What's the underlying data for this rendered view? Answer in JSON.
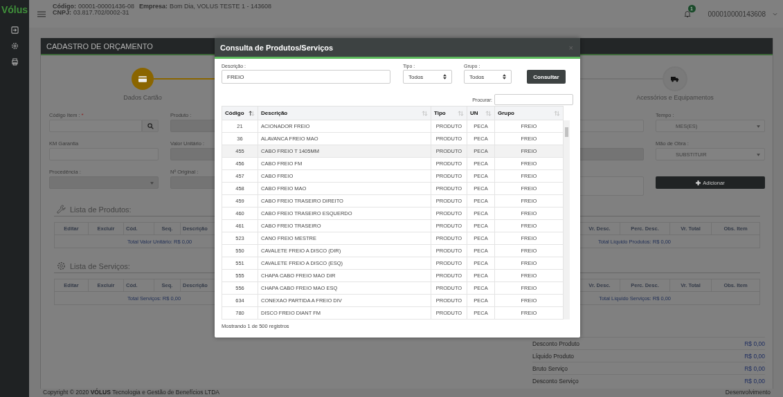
{
  "logo": "Vólus",
  "header": {
    "codigo_label": "Código:",
    "codigo": "00001-00001436-08",
    "empresa_label": "Empresa:",
    "empresa": "Bom Dia, VOLUS TESTE 1 - 143608",
    "cnpj_label": "CNPJ:",
    "cnpj": "03.817.702/0002-31",
    "notification_count": "1",
    "user": "000010000143608"
  },
  "page_title": "CADASTRO DE ORÇAMENTO",
  "steps": [
    {
      "label": "Dados Cartão",
      "active": true
    },
    {
      "label": "Acessórios e Equipamentos",
      "active": false
    }
  ],
  "form": {
    "left": [
      {
        "label": "Código Item :",
        "required_mark": "*",
        "kind": "search"
      },
      {
        "label": "KM Garantia",
        "kind": "text"
      },
      {
        "label": "Procedência :",
        "kind": "select"
      }
    ],
    "middle": [
      {
        "label": "Produto :"
      },
      {
        "label": "Valor Unitário :"
      },
      {
        "label": "Nº Original :"
      }
    ],
    "right": [
      {
        "label": "Tempo :",
        "value": "MES(ES)"
      },
      {
        "label": "Mão de Obra :",
        "value": "SUBSTITUIR"
      }
    ],
    "add_button": "Adicionar"
  },
  "lists": [
    {
      "title": "Lista de Produtos:",
      "left_columns": [
        "Editar",
        "Excluir",
        "Cód.",
        "Seq.",
        "Descrição"
      ],
      "right_columns": [
        "Vr. Desc.",
        "Perc. Desc.",
        "Vr. Total",
        "Obs. Item"
      ],
      "left_total": "Total Valor Unitário: R$ 0,00",
      "right_total": "Total Líquido Produtos: R$ 0,00"
    },
    {
      "title": "Lista de Serviços:",
      "left_columns": [
        "Editar",
        "Excluir",
        "Cód.",
        "Seq.",
        "Descrição"
      ],
      "right_columns": [
        "Vr. Desc.",
        "Perc. Desc.",
        "Vr. Total",
        "Obs. Item"
      ],
      "left_total": "Total Serviços: R$ 0,00",
      "right_total": "Total Líquido Serviços: R$ 0,00"
    }
  ],
  "summary": [
    {
      "label": "Desconto Produto",
      "value": "R$ 0,00"
    },
    {
      "label": "Líquido Produto",
      "value": "R$ 0,00"
    },
    {
      "label": "Bruto Serviço",
      "value": "R$ 0,00"
    },
    {
      "label": "Desconto Serviço",
      "value": "R$ 0,00"
    }
  ],
  "footer": {
    "copyright": "Copyright © 2020 **VÓLUS** Tecnologia e Gestão de Benefícios LTDA",
    "right": "Desenvolvimento"
  },
  "modal": {
    "title": "Consulta de Produtos/Serviços",
    "close": "×",
    "descricao_label": "Descrição :",
    "descricao_value": "FREIO",
    "tipo_label": "Tipo :",
    "tipo_value": "Todos",
    "grupo_label": "Grupo :",
    "grupo_value": "Todos",
    "consult_button": "Consultar",
    "search_label": "Procurar:",
    "columns": [
      {
        "label": "Código",
        "sorted_ascending": true
      },
      {
        "label": "Descrição",
        "sorted_ascending": false
      },
      {
        "label": "Tipo",
        "sorted_ascending": false
      },
      {
        "label": "UN",
        "sorted_ascending": false
      },
      {
        "label": "Grupo",
        "sorted_ascending": false
      }
    ],
    "rows": [
      {
        "cells": [
          "21",
          "ACIONADOR FREIO",
          "PRODUTO",
          "PECA",
          "FREIO"
        ],
        "selected": false
      },
      {
        "cells": [
          "36",
          "ALAVANCA FREIO MAO",
          "PRODUTO",
          "PECA",
          "FREIO"
        ],
        "selected": false
      },
      {
        "cells": [
          "455",
          "CABO FREIO T 1405MM",
          "PRODUTO",
          "PECA",
          "FREIO"
        ],
        "selected": true
      },
      {
        "cells": [
          "456",
          "CABO FREIO FM",
          "PRODUTO",
          "PECA",
          "FREIO"
        ],
        "selected": false
      },
      {
        "cells": [
          "457",
          "CABO FREIO",
          "PRODUTO",
          "PECA",
          "FREIO"
        ],
        "selected": false
      },
      {
        "cells": [
          "458",
          "CABO FREIO MAO",
          "PRODUTO",
          "PECA",
          "FREIO"
        ],
        "selected": false
      },
      {
        "cells": [
          "459",
          "CABO FREIO TRASEIRO DIREITO",
          "PRODUTO",
          "PECA",
          "FREIO"
        ],
        "selected": false
      },
      {
        "cells": [
          "460",
          "CABO FREIO TRASEIRO ESQUERDO",
          "PRODUTO",
          "PECA",
          "FREIO"
        ],
        "selected": false
      },
      {
        "cells": [
          "461",
          "CABO FREIO TRASEIRO",
          "PRODUTO",
          "PECA",
          "FREIO"
        ],
        "selected": false
      },
      {
        "cells": [
          "523",
          "CANO FREIO MESTRE",
          "PRODUTO",
          "PECA",
          "FREIO"
        ],
        "selected": false
      },
      {
        "cells": [
          "550",
          "CAVALETE FREIO A DISCO (DIR)",
          "PRODUTO",
          "PECA",
          "FREIO"
        ],
        "selected": false
      },
      {
        "cells": [
          "551",
          "CAVALETE FREIO A DISCO (ESQ)",
          "PRODUTO",
          "PECA",
          "FREIO"
        ],
        "selected": false
      },
      {
        "cells": [
          "555",
          "CHAPA CABO FREIO MAO DIR",
          "PRODUTO",
          "PECA",
          "FREIO"
        ],
        "selected": false
      },
      {
        "cells": [
          "556",
          "CHAPA CABO FREIO MAO ESQ",
          "PRODUTO",
          "PECA",
          "FREIO"
        ],
        "selected": false
      },
      {
        "cells": [
          "634",
          "CONEXAO PARTIDA A FREIO DIV",
          "PRODUTO",
          "PECA",
          "FREIO"
        ],
        "selected": false
      },
      {
        "cells": [
          "780",
          "DISCO FREIO DIANT FM",
          "PRODUTO",
          "PECA",
          "FREIO"
        ],
        "selected": false
      }
    ],
    "info": "Mostrando 1 de 500 registros"
  }
}
